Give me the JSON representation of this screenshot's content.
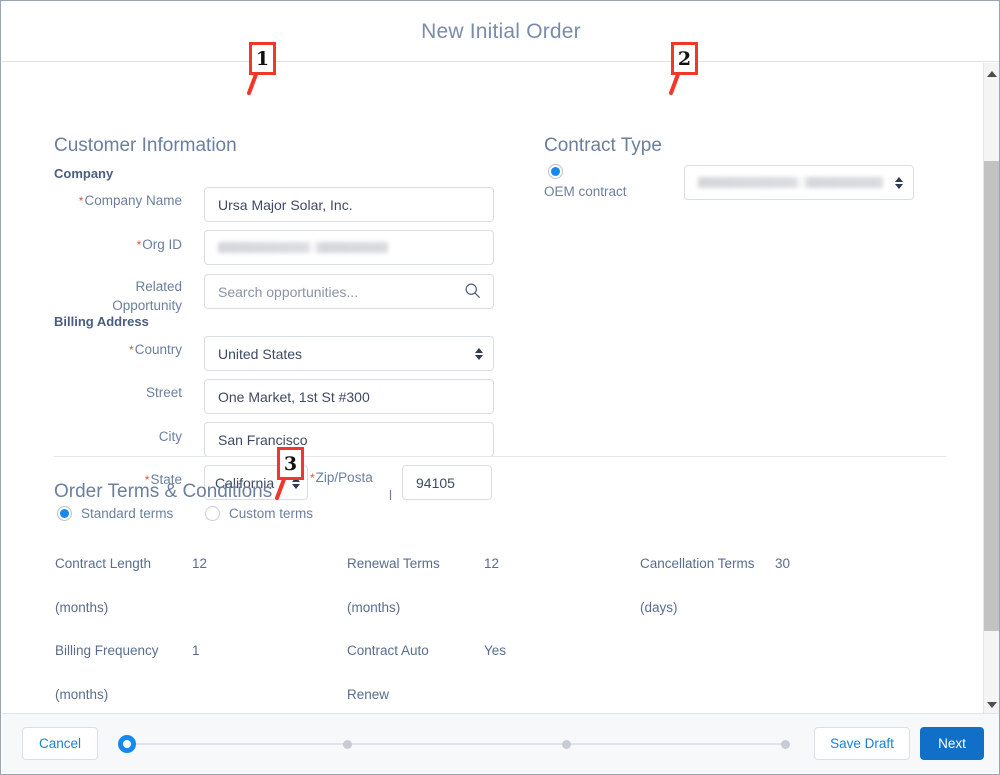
{
  "header": {
    "title": "New Initial Order"
  },
  "customer": {
    "section_title": "Customer Information",
    "company_subtitle": "Company",
    "billing_subtitle": "Billing Address",
    "fields": {
      "company_name": {
        "label": "Company Name",
        "value": "Ursa Major Solar, Inc.",
        "required": true
      },
      "org_id": {
        "label": "Org ID",
        "value": "",
        "required": true,
        "redacted": true
      },
      "related_opportunity": {
        "label_line1": "Related",
        "label_line2": "Opportunity",
        "placeholder": "Search opportunities...",
        "required": false
      },
      "country": {
        "label": "Country",
        "value": "United States",
        "required": true
      },
      "street": {
        "label": "Street",
        "value": "One Market, 1st St #300",
        "required": false
      },
      "city": {
        "label": "City",
        "value": "San Francisco",
        "required": false
      },
      "state": {
        "label": "State",
        "value": "California",
        "required": true
      },
      "zip": {
        "label_line1": "Zip/Posta",
        "label_line2": "l",
        "value": "94105",
        "required": true
      }
    }
  },
  "contract_type": {
    "section_title": "Contract Type",
    "radio_label": "OEM contract",
    "radio_selected": true,
    "dropdown_value": "",
    "dropdown_redacted": true
  },
  "order_terms": {
    "section_title": "Order Terms & Conditions",
    "radios": [
      {
        "label": "Standard terms",
        "selected": true
      },
      {
        "label": "Custom terms",
        "selected": false
      }
    ],
    "items": [
      {
        "label_line1": "Contract Length",
        "label_line2": "(months)",
        "value": "12",
        "col": 0,
        "row": 0
      },
      {
        "label_line1": "Renewal Terms",
        "label_line2": "(months)",
        "value": "12",
        "col": 1,
        "row": 0
      },
      {
        "label_line1": "Cancellation Terms",
        "label_line2": "(days)",
        "value": "30",
        "col": 2,
        "row": 0
      },
      {
        "label_line1": "Billing Frequency",
        "label_line2": "(months)",
        "value": "1",
        "col": 0,
        "row": 1
      },
      {
        "label_line1": "Contract Auto",
        "label_line2": "Renew",
        "value": "Yes",
        "col": 1,
        "row": 1
      }
    ]
  },
  "footer": {
    "cancel_label": "Cancel",
    "save_draft_label": "Save Draft",
    "next_label": "Next",
    "steps": [
      {
        "active": true
      },
      {
        "active": false
      },
      {
        "active": false
      },
      {
        "active": false
      }
    ]
  },
  "callouts": [
    {
      "number": "1",
      "target": "customer-information-section"
    },
    {
      "number": "2",
      "target": "contract-type-section"
    },
    {
      "number": "3",
      "target": "order-terms-section"
    }
  ],
  "colors": {
    "accent_blue": "#1589ee",
    "primary_button": "#1070c8",
    "label_blue": "#6b7f9e",
    "required_red": "#e0533d",
    "callout_red": "#f0372a"
  },
  "icons": {
    "search": "search-icon",
    "stepper": "stepper-updown-icon",
    "scroll_up": "scroll-up-arrow-icon",
    "scroll_down": "scroll-down-arrow-icon"
  }
}
